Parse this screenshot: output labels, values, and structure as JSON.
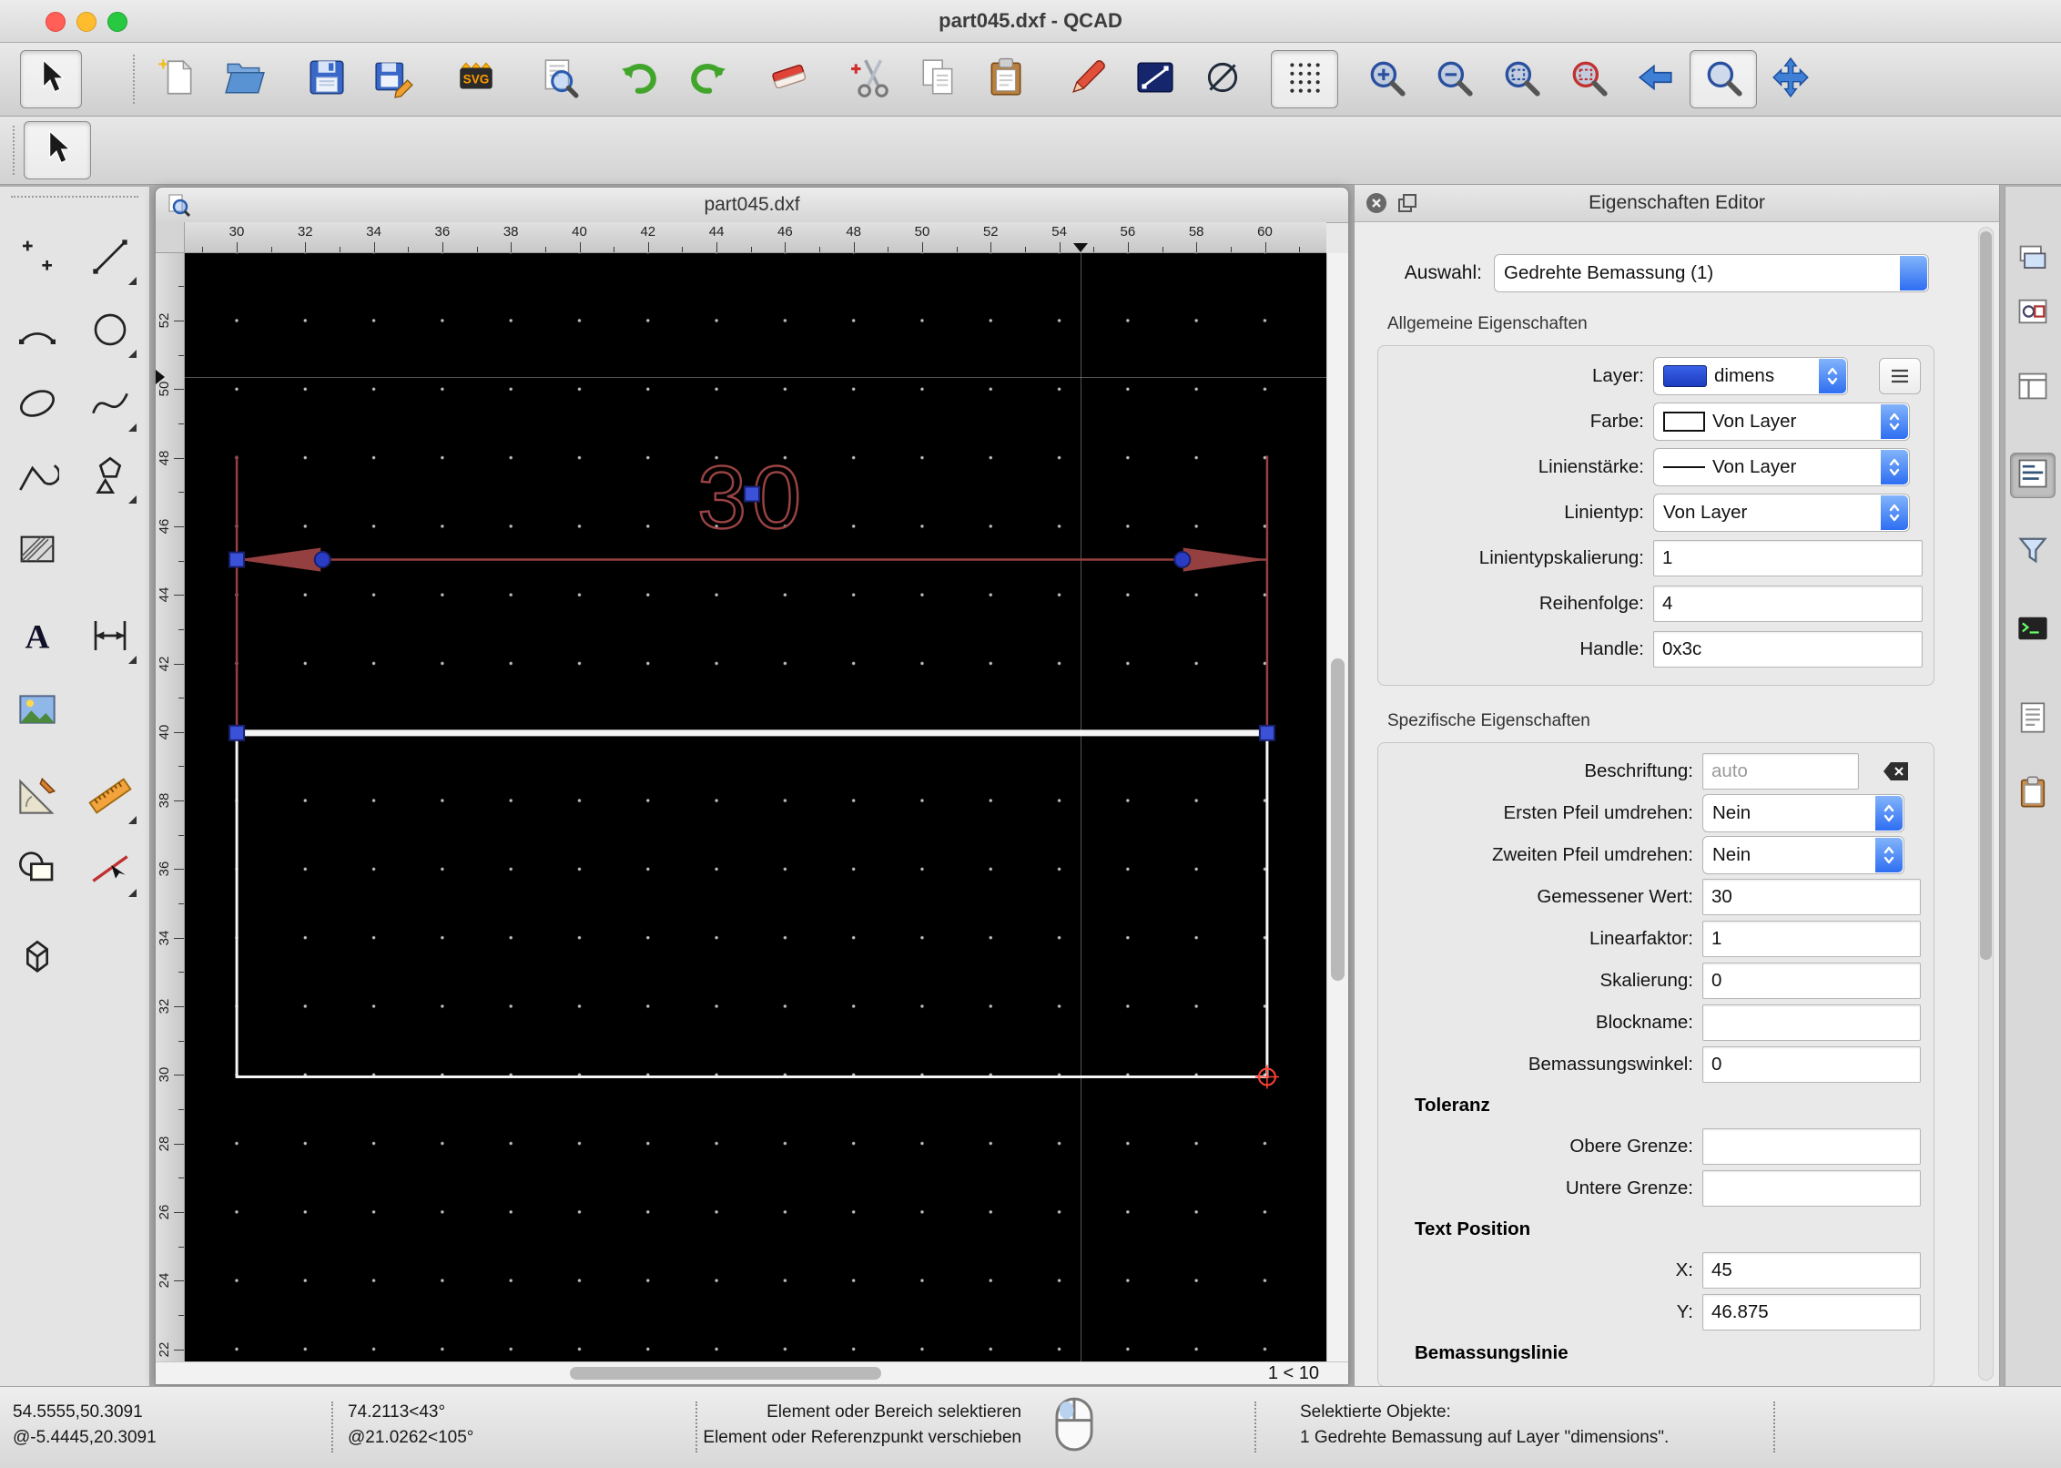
{
  "window": {
    "title": "part045.dxf - QCAD"
  },
  "document": {
    "title": "part045.dxf",
    "zoom_indicator": "1 < 10"
  },
  "rulers": {
    "horizontal": [
      "30",
      "32",
      "34",
      "36",
      "38",
      "40",
      "42",
      "44",
      "46",
      "48",
      "50",
      "52",
      "54",
      "56",
      "58",
      "60"
    ],
    "vertical": [
      "52",
      "50",
      "48",
      "46",
      "44",
      "42",
      "40",
      "38",
      "36",
      "34",
      "32",
      "30",
      "28",
      "26",
      "24",
      "22"
    ]
  },
  "drawing": {
    "dimension_label": "30"
  },
  "toolbar": {
    "main": [
      {
        "id": "selection",
        "pressed": true
      },
      {
        "handle": true
      },
      {
        "id": "new"
      },
      {
        "id": "open"
      },
      {
        "sep": true
      },
      {
        "id": "save"
      },
      {
        "id": "save-as"
      },
      {
        "sep": true
      },
      {
        "id": "svg-export"
      },
      {
        "sep": true
      },
      {
        "id": "print-preview"
      },
      {
        "sep": true
      },
      {
        "id": "undo"
      },
      {
        "id": "redo"
      },
      {
        "sep": true
      },
      {
        "id": "eraser"
      },
      {
        "sep": true
      },
      {
        "id": "cut"
      },
      {
        "id": "copy"
      },
      {
        "id": "paste"
      },
      {
        "sep": true
      },
      {
        "id": "pen"
      },
      {
        "id": "line-props"
      },
      {
        "id": "ellipse-props"
      },
      {
        "sep": true
      },
      {
        "id": "grid-toggle",
        "pressed": true
      },
      {
        "sep": true
      },
      {
        "id": "zoom-in"
      },
      {
        "id": "zoom-out"
      },
      {
        "id": "zoom-auto"
      },
      {
        "id": "zoom-selection"
      },
      {
        "id": "view-previous"
      },
      {
        "id": "magnifier",
        "pressed": true
      },
      {
        "id": "pan"
      }
    ],
    "secondary": [
      {
        "handle": true
      },
      {
        "id": "selection-tool",
        "pressed": true
      }
    ]
  },
  "palette": {
    "rows": [
      [
        "points",
        "line"
      ],
      [
        "arc",
        "circle"
      ],
      [
        "ellipse",
        "spline"
      ],
      [
        "polyline",
        "shapes"
      ],
      [
        "hatch",
        null
      ],
      [
        "text",
        "dimension"
      ],
      [
        "image",
        null
      ],
      [
        "protractor",
        "ruler"
      ],
      [
        "modify",
        "divide"
      ],
      [
        "cube",
        null
      ]
    ],
    "flyouts": [
      "line",
      "circle",
      "spline",
      "shapes",
      "dimension",
      "ruler",
      "divide"
    ]
  },
  "properties_panel": {
    "title": "Eigenschaften Editor",
    "selection": {
      "label": "Auswahl:",
      "value": "Gedrehte Bemassung (1)"
    },
    "general": {
      "title": "Allgemeine Eigenschaften",
      "rows": [
        {
          "label": "Layer:",
          "control": "combo",
          "value": "dimens",
          "swatch": "layer-blue",
          "menu_button": true
        },
        {
          "label": "Farbe:",
          "control": "combo",
          "value": "Von Layer",
          "swatch": "color-white"
        },
        {
          "label": "Linienstärke:",
          "control": "combo",
          "value": "Von Layer",
          "swatch": "line-sample"
        },
        {
          "label": "Linientyp:",
          "control": "combo",
          "value": "Von Layer"
        },
        {
          "label": "Linientypskalierung:",
          "control": "field",
          "value": "1"
        },
        {
          "label": "Reihenfolge:",
          "control": "field",
          "value": "4"
        },
        {
          "label": "Handle:",
          "control": "field",
          "value": "0x3c"
        }
      ]
    },
    "specific": {
      "title": "Spezifische Eigenschaften",
      "rows": [
        {
          "label": "Beschriftung:",
          "control": "field",
          "value": "",
          "placeholder": "auto",
          "clear_button": true,
          "size": "short"
        },
        {
          "label": "Ersten Pfeil umdrehen:",
          "control": "combo",
          "value": "Nein",
          "size": "mid"
        },
        {
          "label": "Zweiten Pfeil umdrehen:",
          "control": "combo",
          "value": "Nein",
          "size": "mid"
        },
        {
          "label": "Gemessener Wert:",
          "control": "field",
          "value": "30"
        },
        {
          "label": "Linearfaktor:",
          "control": "field",
          "value": "1"
        },
        {
          "label": "Skalierung:",
          "control": "field",
          "value": "0"
        },
        {
          "label": "Blockname:",
          "control": "field",
          "value": ""
        },
        {
          "label": "Bemassungswinkel:",
          "control": "field",
          "value": "0"
        },
        {
          "heading": "Toleranz"
        },
        {
          "label": "Obere Grenze:",
          "control": "field",
          "value": ""
        },
        {
          "label": "Untere Grenze:",
          "control": "field",
          "value": ""
        },
        {
          "heading": "Text Position"
        },
        {
          "label": "X:",
          "control": "field",
          "value": "45"
        },
        {
          "label": "Y:",
          "control": "field",
          "value": "46.875"
        },
        {
          "heading": "Bemassungslinie"
        }
      ]
    }
  },
  "right_strip": {
    "items": [
      {
        "id": "panel-layers"
      },
      {
        "id": "panel-blocks"
      },
      {
        "id": "panel-library"
      },
      {
        "id": "panel-properties",
        "pressed": true
      },
      {
        "id": "panel-filter"
      },
      {
        "id": "panel-command"
      },
      {
        "id": "panel-scripts"
      },
      {
        "id": "panel-clipboard"
      }
    ]
  },
  "status_bar": {
    "coordinates": {
      "absolute": "54.5555,50.3091",
      "relative": "@-5.4445,20.3091"
    },
    "polar": {
      "absolute": "74.2113<43°",
      "relative": "@21.0262<105°"
    },
    "hints": {
      "left_click": "Element oder Bereich selektieren",
      "right_click": "Element oder Referenzpunkt verschieben"
    },
    "selection": {
      "title": "Selektierte Objekte:",
      "detail": "1 Gedrehte Bemassung auf Layer \"dimensions\"."
    }
  },
  "colors": {
    "selection_accent": "#2e6ef2",
    "entity_selected": "#954040",
    "handle_blue": "#3b52d8",
    "canvas": "#000000",
    "rect_white": "#f5f5f5",
    "ref_red": "#ff4136"
  }
}
